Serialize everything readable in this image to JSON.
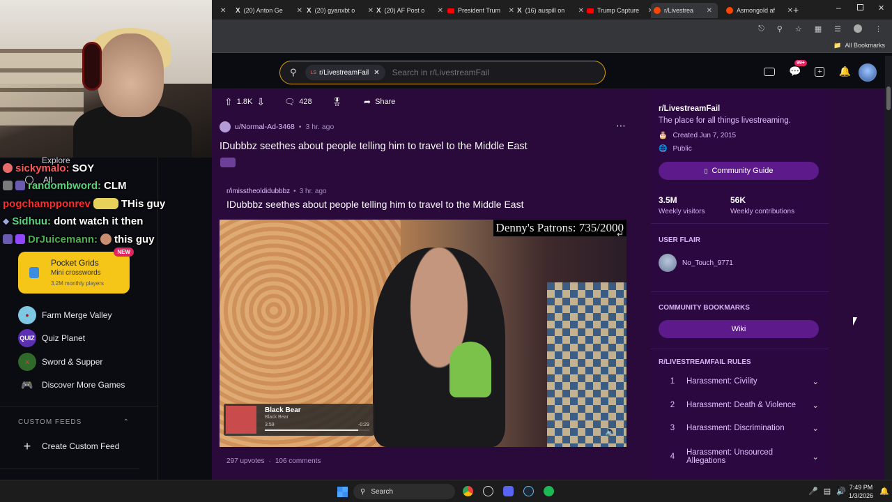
{
  "webcam": {
    "overlay_text": "Explore"
  },
  "chat": [
    {
      "user": "sickymalo:",
      "msg": "SOY",
      "color": "#ff5a5a"
    },
    {
      "user": "randombword:",
      "msg": "CLM",
      "color": "#5ad17a"
    },
    {
      "user": "pogchampponrev",
      "msg": "THis guy",
      "color": "#ff2a2a"
    },
    {
      "user": "Sidhuu:",
      "msg": "dont watch it then",
      "color": "#5ad17a"
    },
    {
      "user": "DrJuicemann:",
      "msg": "this guy",
      "color": "#4caf50"
    }
  ],
  "sidebar": {
    "all_label": "All",
    "promo": {
      "title": "Pocket Grids",
      "subtitle": "Mini crosswords",
      "meta": "3.2M monthly players",
      "badge": "NEW"
    },
    "games": [
      {
        "label": "Farm Merge Valley",
        "icon": "farm-icon"
      },
      {
        "label": "Quiz Planet",
        "icon": "quiz-icon",
        "icon_text": "QUIZ"
      },
      {
        "label": "Sword & Supper",
        "icon": "sword-icon"
      },
      {
        "label": "Discover More Games",
        "icon": "controller-icon"
      }
    ],
    "custom_feeds_heading": "CUSTOM FEEDS",
    "create_feed_label": "Create Custom Feed"
  },
  "browser": {
    "tabs": [
      {
        "label": "(20) Anton Ge"
      },
      {
        "label": "(20) gyanxbt o"
      },
      {
        "label": "(20) AF Post o"
      },
      {
        "label": "President Trum"
      },
      {
        "label": "(16) auspill on"
      },
      {
        "label": "Trump Capture"
      },
      {
        "label": "r/Livestrea"
      },
      {
        "label": "Asmongold af"
      }
    ],
    "bookmarks_label": "All Bookmarks"
  },
  "header": {
    "search_chip": "r/LivestreamFail",
    "search_placeholder": "Search in r/LivestreamFail",
    "notif_count": "99+"
  },
  "post": {
    "score": "1.8K",
    "comments": "428",
    "share_label": "Share",
    "author": "u/Normal-Ad-3468",
    "time": "3 hr. ago",
    "title": "IDubbbz seethes about people telling him to travel to the Middle East",
    "crosspost": {
      "subreddit": "r/imisstheoldidubbbz",
      "time": "3 hr. ago",
      "title": "IDubbbz seethes about people telling him to travel to the Middle East",
      "upvotes": "297 upvotes",
      "comments": "106 comments"
    },
    "video": {
      "overlay": "Denny's Patrons: 735/2000",
      "song": "Black Bear",
      "artist": "Black Bear",
      "elapsed": "3:59",
      "remaining": "-0:29",
      "progress": 0.89
    }
  },
  "community": {
    "name": "r/LivestreamFail",
    "description": "The place for all things livestreaming.",
    "created": "Created Jun 7, 2015",
    "visibility": "Public",
    "guide_label": "Community Guide",
    "stats": [
      {
        "value": "3.5M",
        "label": "Weekly visitors"
      },
      {
        "value": "56K",
        "label": "Weekly contributions"
      }
    ],
    "user_flair_heading": "USER FLAIR",
    "flair_user": "No_Touch_9771",
    "bookmarks_heading": "COMMUNITY BOOKMARKS",
    "wiki_label": "Wiki",
    "rules_heading": "R/LIVESTREAMFAIL RULES",
    "rules": [
      {
        "num": "1",
        "label": "Harassment: Civility"
      },
      {
        "num": "2",
        "label": "Harassment: Death & Violence"
      },
      {
        "num": "3",
        "label": "Harassment: Discrimination"
      },
      {
        "num": "4",
        "label": "Harassment: Unsourced Allegations"
      }
    ]
  },
  "taskbar": {
    "search_label": "Search",
    "time": "7:49 PM",
    "date": "1/3/2026"
  },
  "colors": {
    "accent": "#5c1a8a",
    "brand": "#ff4500",
    "search_border": "#d9a400"
  }
}
